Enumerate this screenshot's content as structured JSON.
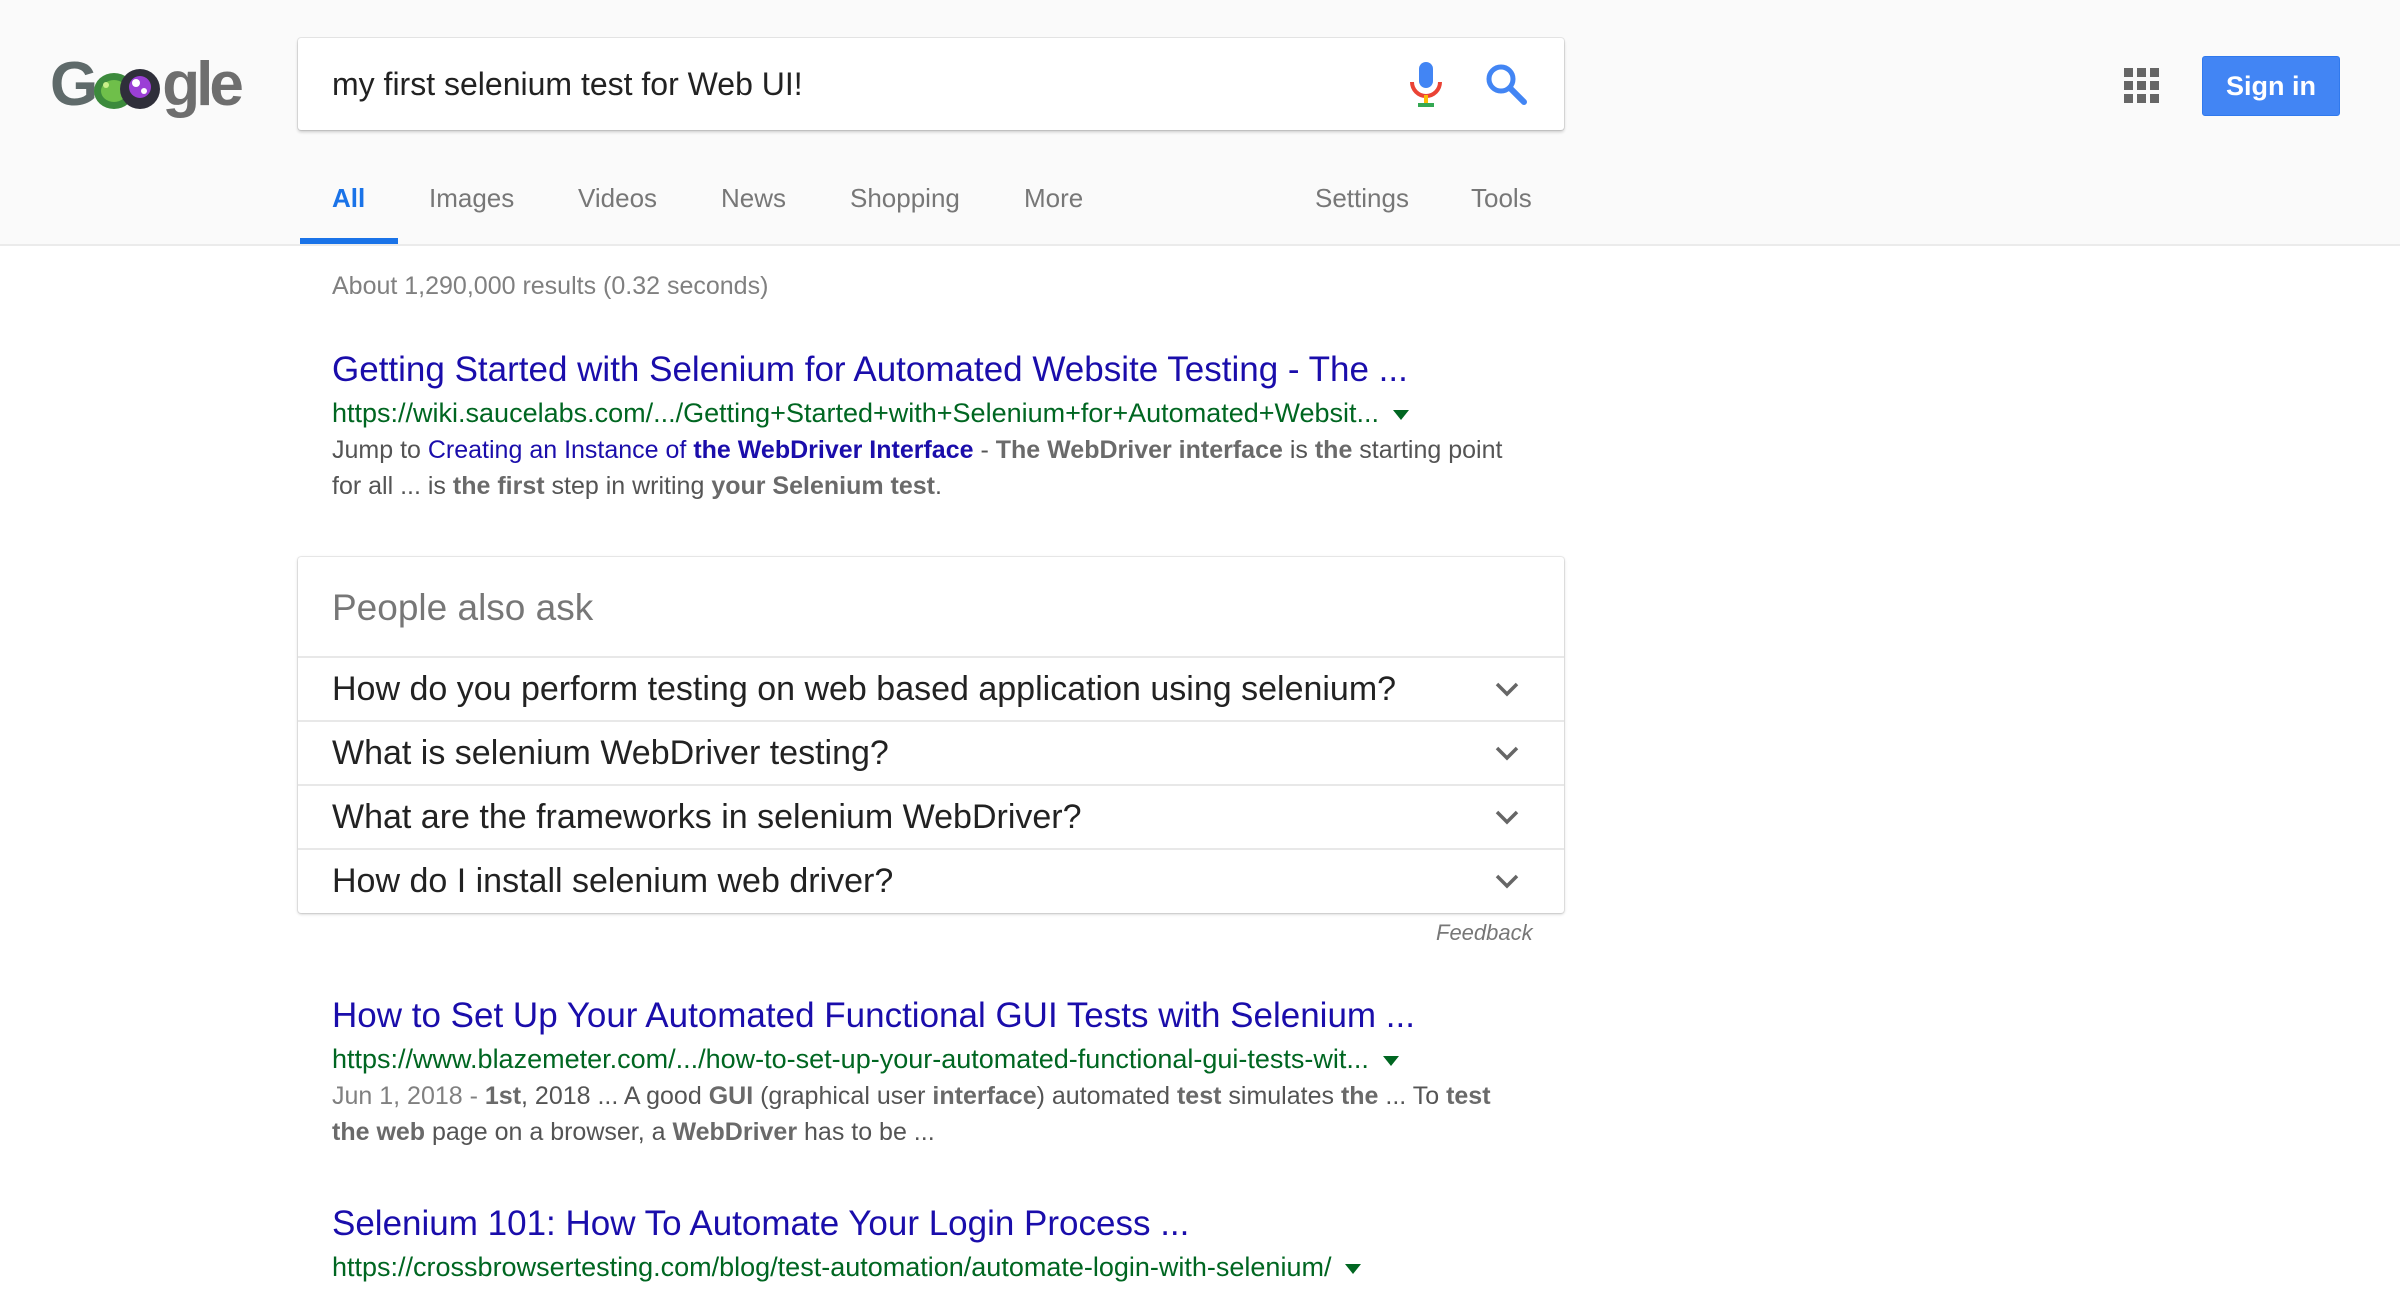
{
  "header": {
    "logo_text": "Google",
    "search": {
      "value": "my first selenium test for Web UI!",
      "mic_icon": "mic-icon",
      "search_icon": "search-icon"
    },
    "apps_icon": "grid-apps-icon",
    "signin_label": "Sign in"
  },
  "tabs": {
    "all": "All",
    "images": "Images",
    "videos": "Videos",
    "news": "News",
    "shopping": "Shopping",
    "more": "More",
    "settings": "Settings",
    "tools": "Tools"
  },
  "result_stats": "About 1,290,000 results (0.32 seconds)",
  "results": [
    {
      "title": "Getting Started with Selenium for Automated Website Testing - The ...",
      "url": "https://wiki.saucelabs.com/.../Getting+Started+with+Selenium+for+Automated+Websit...",
      "snippet": {
        "jump_to": "Jump to ",
        "link_a": "Creating an Instance of ",
        "link_b": "the WebDriver Interface",
        "sep": " - ",
        "b1": "The WebDriver interface",
        "t1": " is ",
        "b2": "the",
        "t2": " starting point for all ... is ",
        "b3": "the first",
        "t3": " step in writing ",
        "b4": "your Selenium test",
        "t4": "."
      }
    },
    {
      "title": "How to Set Up Your Automated Functional GUI Tests with Selenium ...",
      "url": "https://www.blazemeter.com/.../how-to-set-up-your-automated-functional-gui-tests-wit...",
      "snippet": {
        "date": "Jun 1, 2018 - ",
        "b1": "1st",
        "t1": ", 2018 ... A good ",
        "b2": "GUI",
        "t2": " (graphical user ",
        "b3": "interface",
        "t3": ") automated ",
        "b4": "test",
        "t4": " simulates ",
        "b5": "the",
        "t5": " ... To ",
        "b6": "test the web",
        "t6": " page on a browser, a ",
        "b7": "WebDriver",
        "t7": " has to be ..."
      }
    },
    {
      "title": "Selenium 101: How To Automate Your Login Process ...",
      "url": "https://crossbrowsertesting.com/blog/test-automation/automate-login-with-selenium/"
    }
  ],
  "people_also_ask": {
    "heading": "People also ask",
    "questions": [
      "How do you perform testing on web based application using selenium?",
      "What is selenium WebDriver testing?",
      "What are the frameworks in selenium WebDriver?",
      "How do I install selenium web driver?"
    ],
    "feedback": "Feedback"
  },
  "colors": {
    "link_blue": "#1a0dab",
    "url_green": "#006621",
    "accent_blue": "#4285f4",
    "tab_active": "#1a73e8"
  }
}
